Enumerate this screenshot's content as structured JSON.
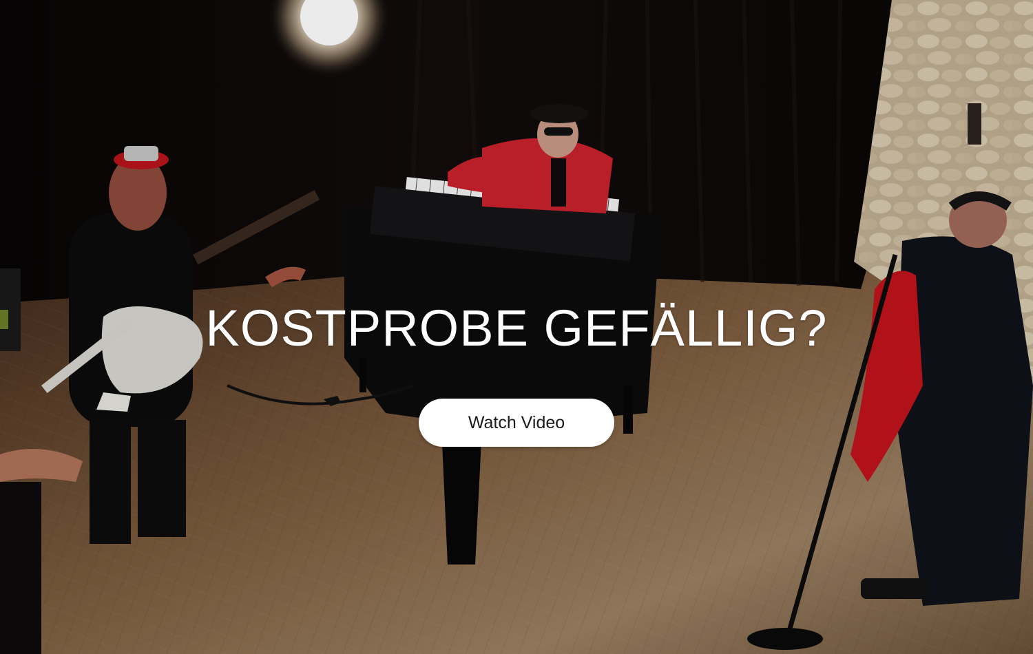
{
  "hero": {
    "headline": "KOSTPROBE GEFÄLLIG?",
    "cta_label": "Watch Video",
    "background": {
      "description_icon": "band-rehearsal-photo",
      "colors": {
        "curtain": "#0d0908",
        "floor": "#8a6e4c",
        "wall": "#c9b79a",
        "shirt_red": "#c8222c"
      }
    },
    "text_color": "#ffffff",
    "button_bg": "#ffffff",
    "button_text_color": "#1a1a1a"
  }
}
